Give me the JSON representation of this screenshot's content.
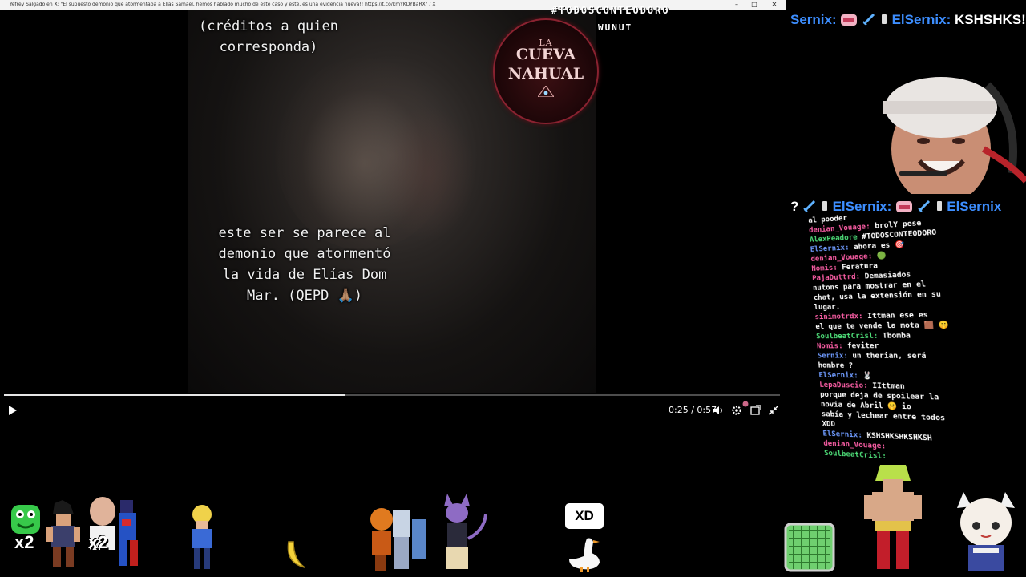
{
  "window": {
    "title": "Yefrey Salgado en X: \"El supuesto demonio que atormentaba a Elías Samael, hemos hablado mucho de este caso y éste, es una evidencia nueva!! https://t.co/kmYKDYBaRX\" / X",
    "minimize_glyph": "–",
    "maximize_glyph": "□",
    "close_glyph": "✕"
  },
  "video": {
    "credits_lines": [
      "(créditos a quien",
      "corresponda)"
    ],
    "caption_lines": [
      "este ser se parece al",
      "demonio que atormentó",
      "la vida de Elías Dom",
      "Mar. (QEPD 🙏🏽)"
    ],
    "logo": {
      "line1": "LA",
      "line2": "CUEVA",
      "line3": "NAHUAL"
    },
    "hashtag": "#TODOSCONTEODORO",
    "overlay_word": "WUNUT",
    "progress_fraction": 0.44,
    "time_display": "0:25 / 0:57"
  },
  "ticker_top": {
    "left_name": "Sernix:",
    "right_name": "ElSernix:",
    "right_text": "KSHSHKS!"
  },
  "ticker_mid": {
    "lead": "?",
    "name": "ElSernix:",
    "tail_name": "ElSernix"
  },
  "chat": [
    {
      "user": "",
      "text": "al pooder",
      "cls": ""
    },
    {
      "user": "denian_Vouage:",
      "text": "brolY pese",
      "cls": ""
    },
    {
      "user": "AlexPeadore",
      "text": "#TODOSCONTEODORO",
      "cls": "green"
    },
    {
      "user": "ElSernix:",
      "text": "ahora es 🎯",
      "cls": "blue"
    },
    {
      "user": "denian_Vouage:",
      "text": "🟢",
      "cls": ""
    },
    {
      "user": "Nomis:",
      "text": "Feratura",
      "cls": ""
    },
    {
      "user": "PajaDuttrd:",
      "text": "Demasiados",
      "cls": ""
    },
    {
      "user": "",
      "text": "nutons para mostrar en el",
      "cls": ""
    },
    {
      "user": "",
      "text": "chat, usa la extensión en su",
      "cls": ""
    },
    {
      "user": "",
      "text": "lugar.",
      "cls": ""
    },
    {
      "user": "sinimotrdx:",
      "text": "Ittman ese es",
      "cls": ""
    },
    {
      "user": "",
      "text": "el que te vende la mota 🟫 🤫",
      "cls": ""
    },
    {
      "user": "SoulbeatCrisl:",
      "text": "Tbomba",
      "cls": "green"
    },
    {
      "user": "Nomis:",
      "text": "feviter",
      "cls": ""
    },
    {
      "user": "Sernix:",
      "text": "un therian, será",
      "cls": "blue"
    },
    {
      "user": "",
      "text": "hombre ?",
      "cls": ""
    },
    {
      "user": "ElSernix:",
      "text": "🐰",
      "cls": "blue"
    },
    {
      "user": "LepaDuscio:",
      "text": "IIttman",
      "cls": ""
    },
    {
      "user": "",
      "text": "porque deja de spoilear la",
      "cls": ""
    },
    {
      "user": "",
      "text": "novia de Abril 🤫 io",
      "cls": ""
    },
    {
      "user": "",
      "text": "sabía y lechear entre todos",
      "cls": ""
    },
    {
      "user": "",
      "text": "XDD",
      "cls": ""
    },
    {
      "user": "ElSernix:",
      "text": "KSHSHKSHKSHKSH",
      "cls": "blue"
    },
    {
      "user": "denian_Vouage:",
      "text": "",
      "cls": ""
    },
    {
      "user": "SoulbeatCrisl:",
      "text": "",
      "cls": "green"
    }
  ],
  "overlay": {
    "x2_left": "x2",
    "x2_mid": "x2",
    "xd": "XD"
  },
  "colors": {
    "accent_blue": "#3d8eff",
    "progress_fill": "#e6e6e6",
    "progress_track": "#4d4d4d"
  }
}
